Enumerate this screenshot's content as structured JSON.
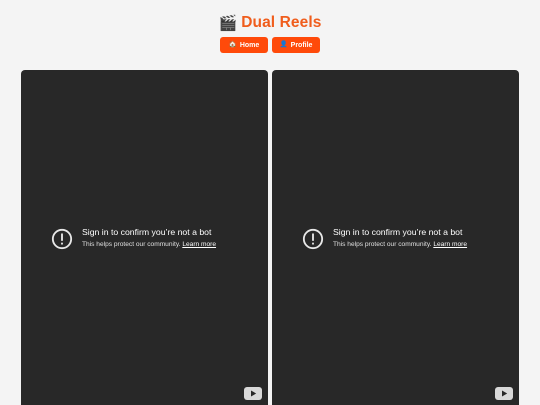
{
  "header": {
    "emoji": "🎬",
    "title": "Dual Reels",
    "title_color": "#f05d1c"
  },
  "nav": {
    "home": {
      "icon": "🏠",
      "label": "Home"
    },
    "profile": {
      "icon": "👤",
      "label": "Profile"
    },
    "button_color": "#ff4a0a"
  },
  "players": [
    {
      "icon": "warning-circle-icon",
      "title": "Sign in to confirm you’re not a bot",
      "subtitle": "This helps protect our community.",
      "link": "Learn more",
      "brand_icon": "youtube-icon"
    },
    {
      "icon": "warning-circle-icon",
      "title": "Sign in to confirm you’re not a bot",
      "subtitle": "This helps protect our community.",
      "link": "Learn more",
      "brand_icon": "youtube-icon"
    }
  ],
  "colors": {
    "background": "#f4f4f4",
    "player_bg": "#282828"
  }
}
